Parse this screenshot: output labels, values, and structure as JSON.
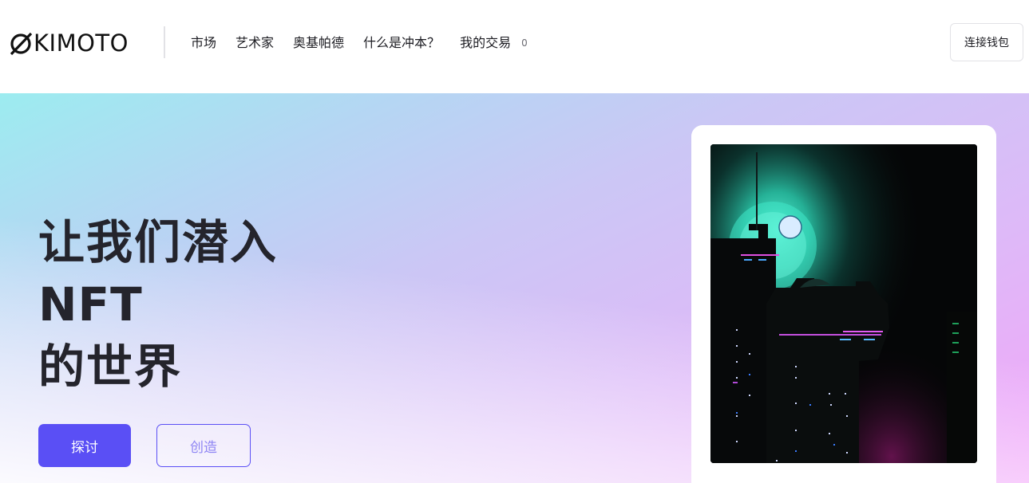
{
  "header": {
    "logo_text": "KIMOTO",
    "logo_icon": "slashed-o-logo-icon",
    "nav": [
      {
        "label": "市场"
      },
      {
        "label": "艺术家"
      },
      {
        "label": "奥基帕德"
      },
      {
        "label": "什么是冲本？"
      },
      {
        "label": "我的交易"
      }
    ],
    "trades_count": "0",
    "connect_wallet_label": "连接钱包"
  },
  "hero": {
    "headline_line1": "让我们潜入",
    "headline_line2": "NFT",
    "headline_line3": "的世界",
    "explore_label": "探讨",
    "create_label": "创造",
    "accent_color": "#5a4ff5",
    "gradient_colors": [
      "#9cecf0",
      "#cbc7f5",
      "#f2a5f9"
    ]
  },
  "artwork": {
    "subject": "cyberpunk-city-night-illustration",
    "glow_color": "#2fe0c0",
    "neon_color": "#d84bf0"
  }
}
